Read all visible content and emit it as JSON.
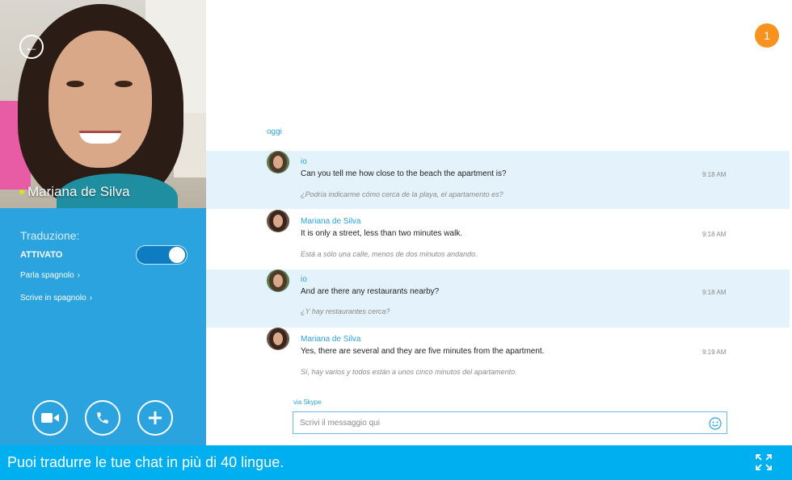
{
  "call": {
    "contact_name": "Mariana de Silva",
    "back_icon": "arrow-left-icon",
    "presence_color": "#d8e31a"
  },
  "translation": {
    "label": "Traduzione:",
    "state": "ATTIVATO",
    "enabled": true,
    "speaks": "Parla spagnolo",
    "writes": "Scrive in spagnolo"
  },
  "call_controls": [
    "video-icon",
    "phone-icon",
    "add-icon"
  ],
  "notification": {
    "count": "1",
    "color": "#f7921e"
  },
  "chat": {
    "day_label": "oggi",
    "messages": [
      {
        "sender": "io",
        "text": "Can you tell me how close to the beach the apartment is?",
        "translation": "¿Podría indicarme cómo cerca de la playa, el apartamento es?",
        "time": "9:18 AM"
      },
      {
        "sender": "Mariana de Silva",
        "text": "It is only a street, less than two minutes walk.",
        "translation": "Está a sólo una calle, menos de dos minutos andando.",
        "time": "9:18 AM"
      },
      {
        "sender": "io",
        "text": "And are there any restaurants nearby?",
        "translation": "¿Y hay restaurantes cerca?",
        "time": "9:18 AM"
      },
      {
        "sender": "Mariana de Silva",
        "text": "Yes, there are several and they are five minutes from the apartment.",
        "translation": "Sí, hay varios y todos están a unos cinco minutos del apartamento.",
        "time": "9:19 AM"
      }
    ],
    "via_label": "via Skype",
    "input_placeholder": "Scrivi il messaggio qui"
  },
  "caption": {
    "text": "Puoi tradurre le tue chat in più di 40 lingue.",
    "bar_color": "#00aff0"
  },
  "colors": {
    "accent": "#2aa3df",
    "own_message_bg": "#e3f2fb"
  }
}
